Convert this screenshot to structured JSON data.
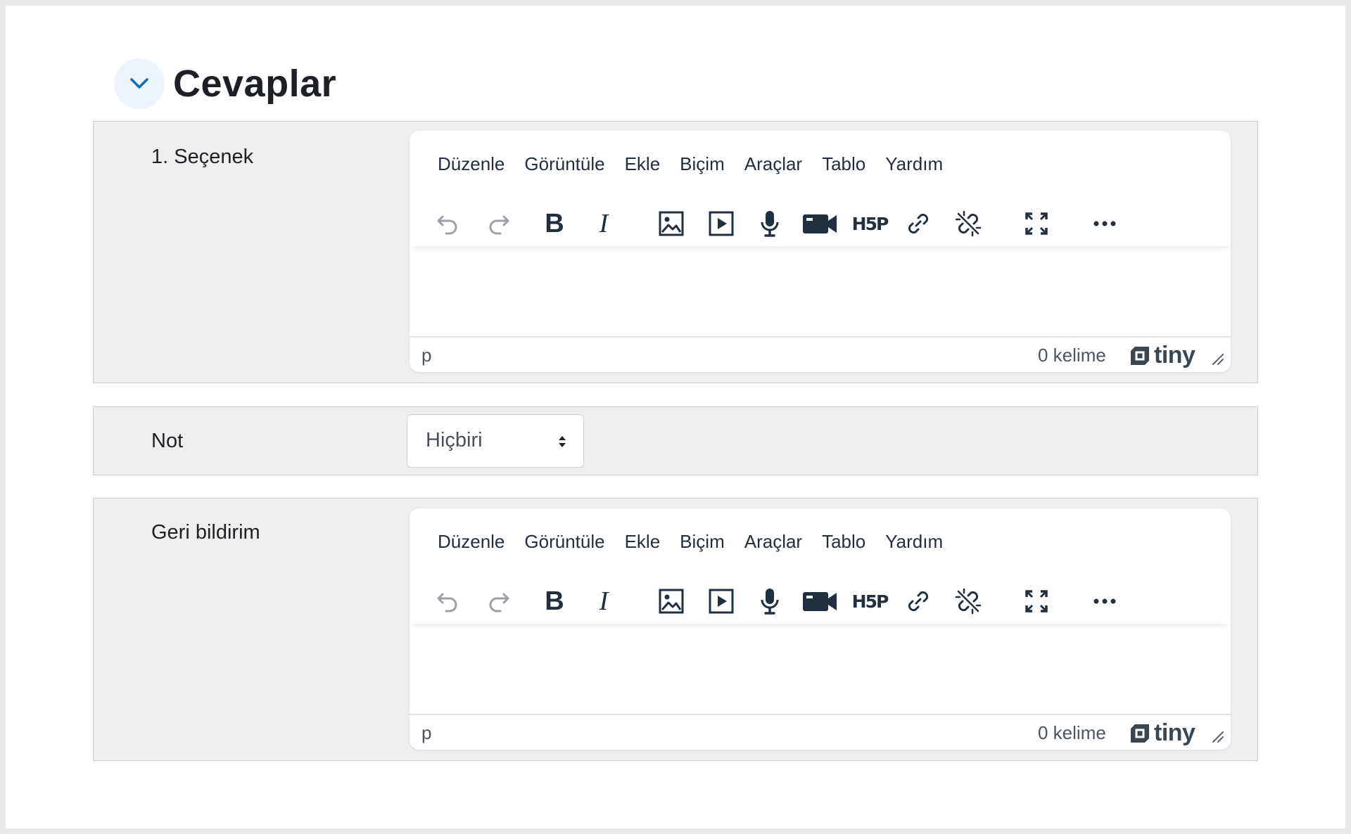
{
  "section": {
    "title": "Cevaplar",
    "collapse_icon": "chevron-down-icon"
  },
  "option_row": {
    "label": "1. Seçenek"
  },
  "grade_row": {
    "label": "Not",
    "selected": "Hiçbiri"
  },
  "feedback_row": {
    "label": "Geri bildirim"
  },
  "editor": {
    "menu": [
      "Düzenle",
      "Görüntüle",
      "Ekle",
      "Biçim",
      "Araçlar",
      "Tablo",
      "Yardım"
    ],
    "toolbar_icons": [
      "undo-icon",
      "redo-icon",
      "bold-icon",
      "italic-icon",
      "image-icon",
      "media-icon",
      "microphone-icon",
      "video-camera-icon",
      "h5p-icon",
      "link-icon",
      "unlink-icon",
      "fullscreen-icon",
      "more-icon"
    ],
    "bold_glyph": "B",
    "italic_glyph": "I",
    "h5p_glyph": "H5P",
    "path": "p",
    "word_count": "0 kelime",
    "brand": "tiny"
  },
  "colors": {
    "accent": "#0f6cbf",
    "row_bg": "#eeeeee",
    "page_bg": "#ffffff",
    "icon": "#222f3e"
  }
}
